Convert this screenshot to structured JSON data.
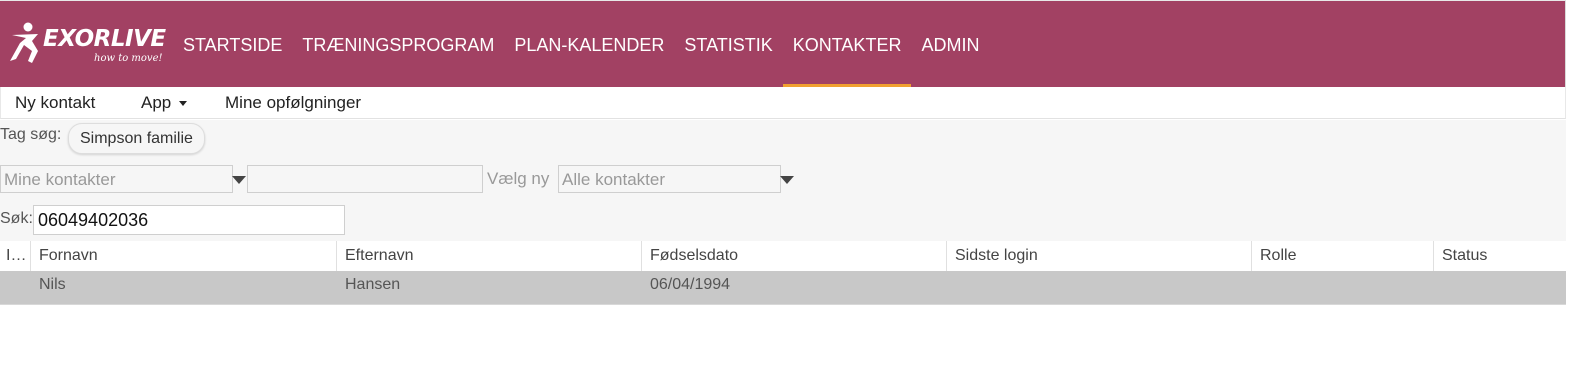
{
  "app": {
    "logo_text": "EXORLIVE",
    "logo_tagline": "how to move!"
  },
  "nav": {
    "items": [
      {
        "label": "STARTSIDE"
      },
      {
        "label": "TRÆNINGSPROGRAM"
      },
      {
        "label": "PLAN-KALENDER"
      },
      {
        "label": "STATISTIK"
      },
      {
        "label": "KONTAKTER",
        "active": true
      },
      {
        "label": "ADMIN"
      }
    ]
  },
  "subnav": {
    "new_contact": "Ny kontakt",
    "app": "App",
    "followups": "Mine opfølgninger"
  },
  "filters": {
    "tag_label": "Tag søg:",
    "tag_chip": "Simpson familie",
    "contacts_select": "Mine kontakter",
    "middle_input": "",
    "choose_new_label": "Vælg ny",
    "all_contacts_select": "Alle kontakter",
    "search_label": "Søk:",
    "search_value": "06049402036"
  },
  "table": {
    "columns": [
      "I…",
      "Fornavn",
      "Efternavn",
      "Fødselsdato",
      "Sidste login",
      "Rolle",
      "Status"
    ],
    "rows": [
      {
        "i": "",
        "first": "Nils",
        "last": "Hansen",
        "dob": "06/04/1994",
        "login": "",
        "role": "",
        "status": ""
      }
    ]
  },
  "colors": {
    "header_bg": "#a24163",
    "active_underline": "#f0a030",
    "selected_row": "#c8c8c8"
  }
}
